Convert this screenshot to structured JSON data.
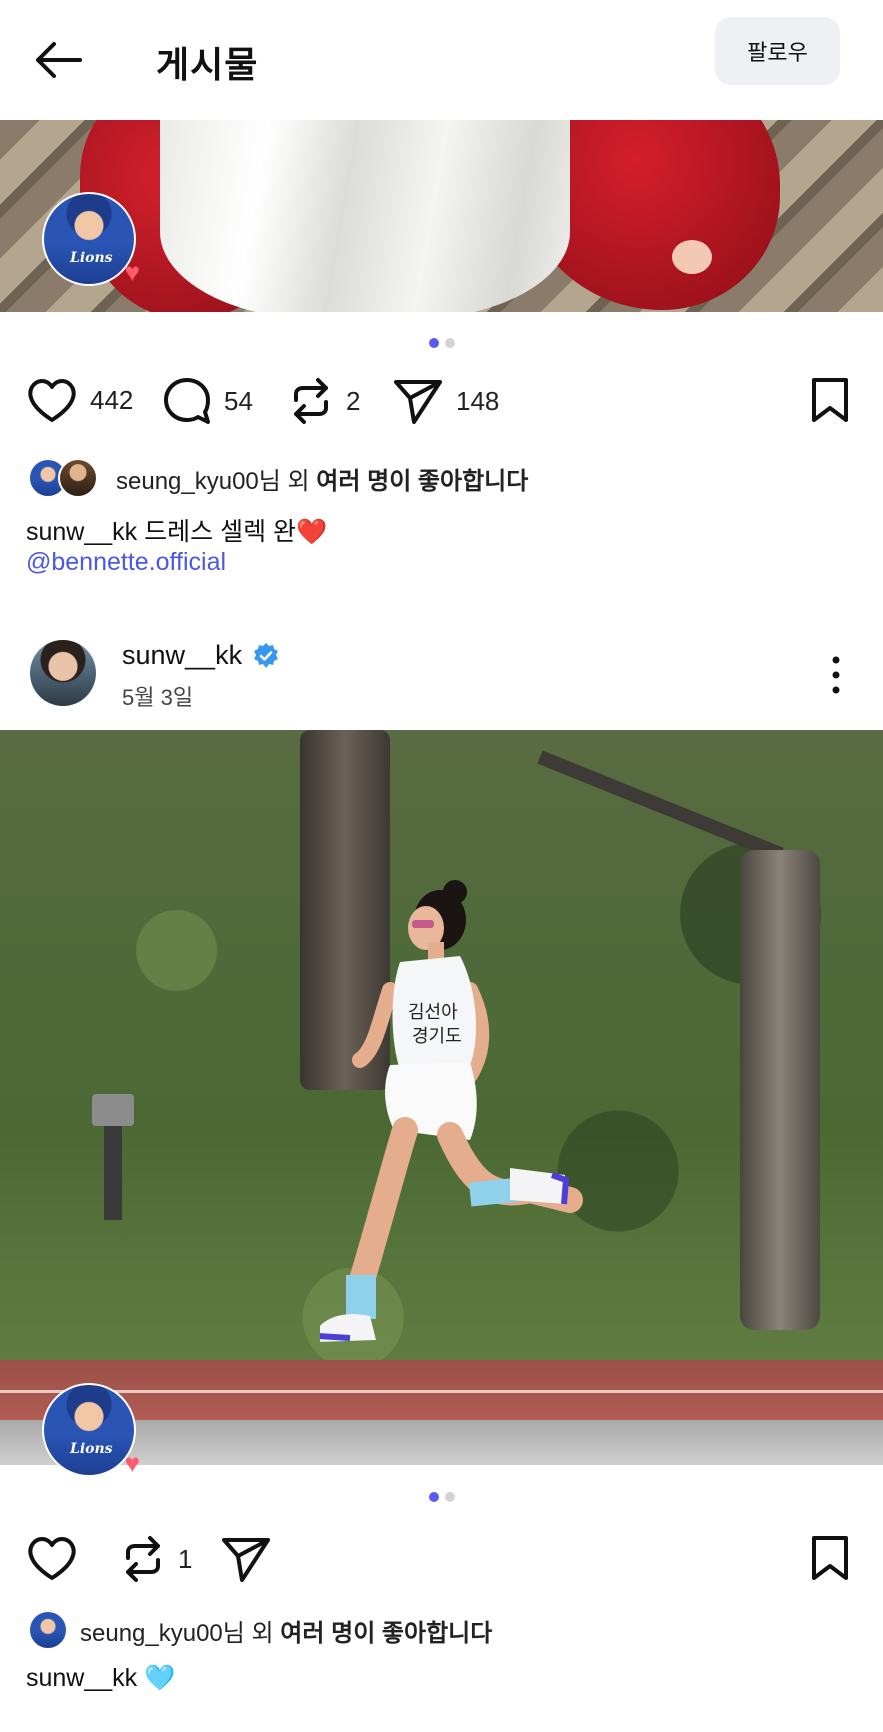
{
  "header": {
    "title": "게시물",
    "follow_label": "팔로우"
  },
  "post1": {
    "stats": {
      "likes": "442",
      "comments": "54",
      "reposts": "2",
      "shares": "148"
    },
    "likers": {
      "username": "seung_kyu00",
      "suffix": "님 외 ",
      "rest": "여러 명이 좋아합니다"
    },
    "caption": {
      "author": "sunw__kk",
      "text": " 드레스 셀렉 완",
      "emoji": "❤️"
    },
    "mention": "@bennette.official",
    "carousel": {
      "count": 2,
      "active": 1
    }
  },
  "post2": {
    "author": "sunw__kk",
    "date": "5월 3일",
    "stats": {
      "reposts": "1"
    },
    "likers": {
      "username": "seung_kyu00",
      "suffix": "님 외 ",
      "rest": "여러 명이 좋아합니다"
    },
    "caption": {
      "author": "sunw__kk",
      "emoji": "🩵"
    },
    "bib_text": "김선아\n경기도",
    "carousel": {
      "count": 2,
      "active": 1
    }
  },
  "badge_logo": "Lions",
  "colors": {
    "accent": "#5b5bf0",
    "mention": "#4b57e8",
    "verified": "#3897f0",
    "heart": "#ff4d6a"
  },
  "icons": [
    "back-arrow-icon",
    "heart-icon",
    "comment-icon",
    "repost-icon",
    "send-icon",
    "bookmark-icon",
    "verified-icon",
    "more-vertical-icon"
  ]
}
